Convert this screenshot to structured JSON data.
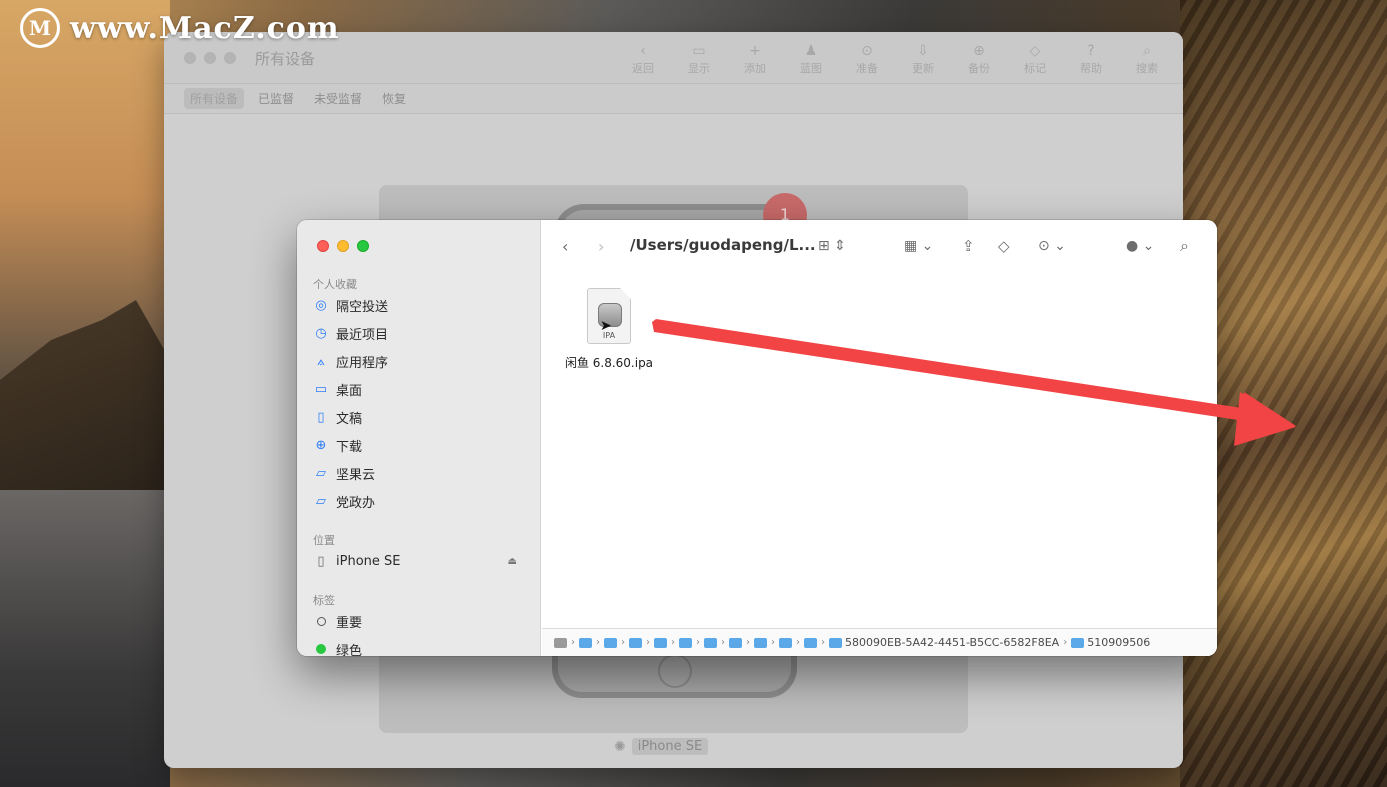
{
  "watermark": {
    "logo_letter": "M",
    "text": "www.MacZ.com"
  },
  "bg_window": {
    "title": "所有设备",
    "toolbar": [
      {
        "icon": "‹",
        "label": "返回"
      },
      {
        "icon": "▭",
        "label": "显示"
      },
      {
        "icon": "+",
        "label": "添加"
      },
      {
        "icon": "♟",
        "label": "蓝图"
      },
      {
        "icon": "⊙",
        "label": "准备"
      },
      {
        "icon": "⇩",
        "label": "更新"
      },
      {
        "icon": "⊕",
        "label": "备份"
      },
      {
        "icon": "◇",
        "label": "标记"
      },
      {
        "icon": "?",
        "label": "帮助"
      },
      {
        "icon": "⌕",
        "label": "搜索"
      }
    ],
    "tabs": [
      "所有设备",
      "已监督",
      "未受监督",
      "恢复"
    ],
    "badge": "1",
    "device_label": "iPhone SE"
  },
  "finder": {
    "path_title": "/Users/guodapeng/L...",
    "sections": {
      "favorites": "个人收藏",
      "locations": "位置",
      "tags": "标签"
    },
    "favorites": [
      {
        "label": "隔空投送",
        "icon": "airdrop-icon"
      },
      {
        "label": "最近项目",
        "icon": "clock-icon"
      },
      {
        "label": "应用程序",
        "icon": "applications-icon"
      },
      {
        "label": "桌面",
        "icon": "desktop-icon"
      },
      {
        "label": "文稿",
        "icon": "document-icon"
      },
      {
        "label": "下载",
        "icon": "download-icon"
      },
      {
        "label": "坚果云",
        "icon": "folder-icon"
      },
      {
        "label": "党政办",
        "icon": "folder-icon"
      }
    ],
    "locations": [
      {
        "label": "iPhone SE",
        "icon": "iphone-icon"
      }
    ],
    "tags": [
      {
        "label": "重要",
        "color": "#ffffff"
      },
      {
        "label": "绿色",
        "color": "#28c840"
      }
    ],
    "file": {
      "name": "闲鱼 6.8.60.ipa",
      "ext": "IPA"
    },
    "pathbar": {
      "long_folder": "580090EB-5A42-4451-B5CC-6582F8EA",
      "last_folder": "510909506"
    }
  },
  "colors": {
    "arrow": "#f24444",
    "accent": "#2d7cf6"
  }
}
